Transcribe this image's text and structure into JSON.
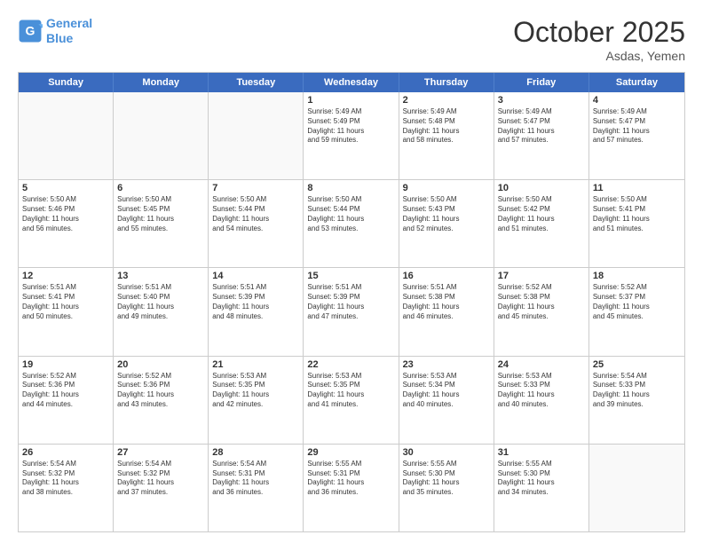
{
  "logo": {
    "line1": "General",
    "line2": "Blue"
  },
  "title": "October 2025",
  "subtitle": "Asdas, Yemen",
  "days": [
    "Sunday",
    "Monday",
    "Tuesday",
    "Wednesday",
    "Thursday",
    "Friday",
    "Saturday"
  ],
  "rows": [
    [
      {
        "num": "",
        "info": ""
      },
      {
        "num": "",
        "info": ""
      },
      {
        "num": "",
        "info": ""
      },
      {
        "num": "1",
        "info": "Sunrise: 5:49 AM\nSunset: 5:49 PM\nDaylight: 11 hours\nand 59 minutes."
      },
      {
        "num": "2",
        "info": "Sunrise: 5:49 AM\nSunset: 5:48 PM\nDaylight: 11 hours\nand 58 minutes."
      },
      {
        "num": "3",
        "info": "Sunrise: 5:49 AM\nSunset: 5:47 PM\nDaylight: 11 hours\nand 57 minutes."
      },
      {
        "num": "4",
        "info": "Sunrise: 5:49 AM\nSunset: 5:47 PM\nDaylight: 11 hours\nand 57 minutes."
      }
    ],
    [
      {
        "num": "5",
        "info": "Sunrise: 5:50 AM\nSunset: 5:46 PM\nDaylight: 11 hours\nand 56 minutes."
      },
      {
        "num": "6",
        "info": "Sunrise: 5:50 AM\nSunset: 5:45 PM\nDaylight: 11 hours\nand 55 minutes."
      },
      {
        "num": "7",
        "info": "Sunrise: 5:50 AM\nSunset: 5:44 PM\nDaylight: 11 hours\nand 54 minutes."
      },
      {
        "num": "8",
        "info": "Sunrise: 5:50 AM\nSunset: 5:44 PM\nDaylight: 11 hours\nand 53 minutes."
      },
      {
        "num": "9",
        "info": "Sunrise: 5:50 AM\nSunset: 5:43 PM\nDaylight: 11 hours\nand 52 minutes."
      },
      {
        "num": "10",
        "info": "Sunrise: 5:50 AM\nSunset: 5:42 PM\nDaylight: 11 hours\nand 51 minutes."
      },
      {
        "num": "11",
        "info": "Sunrise: 5:50 AM\nSunset: 5:41 PM\nDaylight: 11 hours\nand 51 minutes."
      }
    ],
    [
      {
        "num": "12",
        "info": "Sunrise: 5:51 AM\nSunset: 5:41 PM\nDaylight: 11 hours\nand 50 minutes."
      },
      {
        "num": "13",
        "info": "Sunrise: 5:51 AM\nSunset: 5:40 PM\nDaylight: 11 hours\nand 49 minutes."
      },
      {
        "num": "14",
        "info": "Sunrise: 5:51 AM\nSunset: 5:39 PM\nDaylight: 11 hours\nand 48 minutes."
      },
      {
        "num": "15",
        "info": "Sunrise: 5:51 AM\nSunset: 5:39 PM\nDaylight: 11 hours\nand 47 minutes."
      },
      {
        "num": "16",
        "info": "Sunrise: 5:51 AM\nSunset: 5:38 PM\nDaylight: 11 hours\nand 46 minutes."
      },
      {
        "num": "17",
        "info": "Sunrise: 5:52 AM\nSunset: 5:38 PM\nDaylight: 11 hours\nand 45 minutes."
      },
      {
        "num": "18",
        "info": "Sunrise: 5:52 AM\nSunset: 5:37 PM\nDaylight: 11 hours\nand 45 minutes."
      }
    ],
    [
      {
        "num": "19",
        "info": "Sunrise: 5:52 AM\nSunset: 5:36 PM\nDaylight: 11 hours\nand 44 minutes."
      },
      {
        "num": "20",
        "info": "Sunrise: 5:52 AM\nSunset: 5:36 PM\nDaylight: 11 hours\nand 43 minutes."
      },
      {
        "num": "21",
        "info": "Sunrise: 5:53 AM\nSunset: 5:35 PM\nDaylight: 11 hours\nand 42 minutes."
      },
      {
        "num": "22",
        "info": "Sunrise: 5:53 AM\nSunset: 5:35 PM\nDaylight: 11 hours\nand 41 minutes."
      },
      {
        "num": "23",
        "info": "Sunrise: 5:53 AM\nSunset: 5:34 PM\nDaylight: 11 hours\nand 40 minutes."
      },
      {
        "num": "24",
        "info": "Sunrise: 5:53 AM\nSunset: 5:33 PM\nDaylight: 11 hours\nand 40 minutes."
      },
      {
        "num": "25",
        "info": "Sunrise: 5:54 AM\nSunset: 5:33 PM\nDaylight: 11 hours\nand 39 minutes."
      }
    ],
    [
      {
        "num": "26",
        "info": "Sunrise: 5:54 AM\nSunset: 5:32 PM\nDaylight: 11 hours\nand 38 minutes."
      },
      {
        "num": "27",
        "info": "Sunrise: 5:54 AM\nSunset: 5:32 PM\nDaylight: 11 hours\nand 37 minutes."
      },
      {
        "num": "28",
        "info": "Sunrise: 5:54 AM\nSunset: 5:31 PM\nDaylight: 11 hours\nand 36 minutes."
      },
      {
        "num": "29",
        "info": "Sunrise: 5:55 AM\nSunset: 5:31 PM\nDaylight: 11 hours\nand 36 minutes."
      },
      {
        "num": "30",
        "info": "Sunrise: 5:55 AM\nSunset: 5:30 PM\nDaylight: 11 hours\nand 35 minutes."
      },
      {
        "num": "31",
        "info": "Sunrise: 5:55 AM\nSunset: 5:30 PM\nDaylight: 11 hours\nand 34 minutes."
      },
      {
        "num": "",
        "info": ""
      }
    ]
  ]
}
